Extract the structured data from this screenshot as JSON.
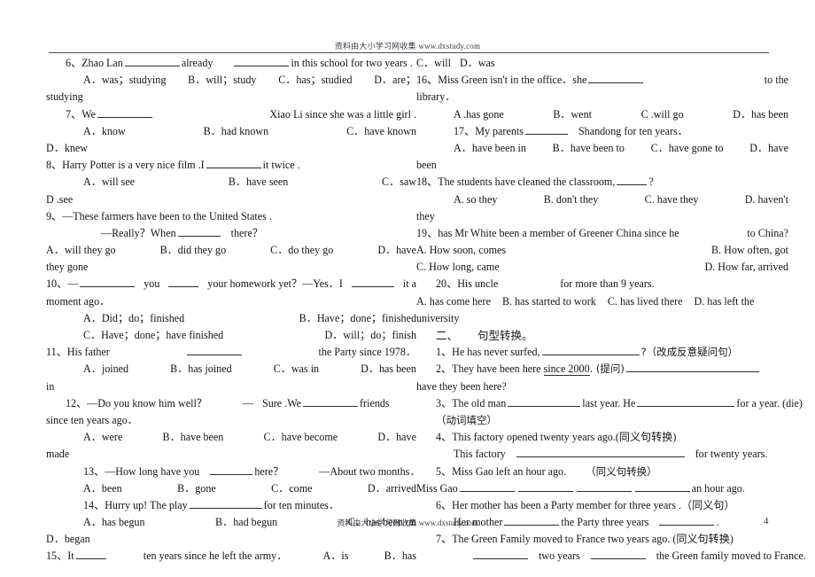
{
  "header": {
    "watermark_cn": "资料由大小学习网收集",
    "watermark_url": "www.dxstudy.com"
  },
  "footer": {
    "watermark_cn": "资料由大小学习网收集",
    "watermark_url": "www.dxstudy.com",
    "page_number": "4"
  },
  "left_column": {
    "q6": {
      "stem_a": "6、Zhao Lan",
      "stem_b": "already",
      "stem_c": "in this school for two years .",
      "opt_a": "A．was；studying",
      "opt_b": "B．will；study",
      "opt_c": "C．has；studied",
      "opt_d": "D．are；",
      "opt_d_cont": "studying"
    },
    "q7": {
      "stem": "7、We",
      "stem_cont": "Xiao Li since she was a little girl .",
      "opt_a": "A．know",
      "opt_b": "B．had known",
      "opt_c": "C．have known",
      "opt_d": "D．knew"
    },
    "q8": {
      "stem_a": "8、Harry Potter is a very nice film .I",
      "stem_b": "it twice .",
      "opt_a": "A．will see",
      "opt_b": "B．have seen",
      "opt_c": "C．saw",
      "opt_d": "D .see"
    },
    "q9": {
      "stem_a": "9、—These farmers have been to the United States .",
      "stem_b": "—Really？When",
      "stem_b_cont": "there？",
      "opt_a": "A．will they go",
      "opt_b": "B．did they go",
      "opt_c": "C．do they go",
      "opt_d": "D．have",
      "opt_d_cont": "they gone"
    },
    "q10": {
      "stem_a": "10、—",
      "stem_b": "you",
      "stem_c": "your homework yet？—Yes．I",
      "stem_d": "it a",
      "stem_e": "moment ago．",
      "opt_a": "A．Did；do；finished",
      "opt_b": "B．Have；done；finished",
      "opt_c": "C．Have；done；have finished",
      "opt_d": "D．will；do；finish"
    },
    "q11": {
      "stem_a": "11、His father",
      "stem_b": "the Party since 1978．",
      "opt_a": "A．joined",
      "opt_b": "B．has joined",
      "opt_c": "C．was in",
      "opt_d": "D．has been",
      "opt_d_cont": "in"
    },
    "q12": {
      "stem_a": "12、—Do you know him well？",
      "stem_b": "—",
      "stem_c": "Sure .We",
      "stem_d": "friends",
      "stem_e": "since ten years ago．",
      "opt_a": "A．were",
      "opt_b": "B．have been",
      "opt_c": "C．have become",
      "opt_d": "D．have",
      "opt_d_cont": "made"
    },
    "q13": {
      "stem_a": "13、—How long have you",
      "stem_b": "here？",
      "stem_c": "—About two months．",
      "opt_a": "A．been",
      "opt_b": "B．gone",
      "opt_c": "C．come",
      "opt_d": "D．arrived"
    },
    "q14": {
      "stem_a": "14、Hurry up! The play",
      "stem_b": "for ten minutes．",
      "opt_a": "A．has begun",
      "opt_b": "B．had begun",
      "opt_c": "C．has been on",
      "opt_d": "D．began"
    },
    "q15": {
      "stem_a": "15、It",
      "stem_b": "ten years since he left the army．",
      "opt_a": "A．is",
      "opt_b": "B．has"
    }
  },
  "right_column": {
    "q15_cont": {
      "opt_c": "C．will",
      "opt_d": "D．was"
    },
    "q16": {
      "stem_a": "16、Miss Green isn't in the office．she",
      "stem_b": "to the",
      "stem_c": "library．",
      "opt_a": "A .has gone",
      "opt_b": "B．went",
      "opt_c": "C .will go",
      "opt_d": "D．has been"
    },
    "q17": {
      "stem_a": "17、My parents",
      "stem_b": "Shandong for ten years．",
      "opt_a": "A．have been in",
      "opt_b": "B．have been to",
      "opt_c": "C．have gone to",
      "opt_d": "D．have",
      "opt_d_cont": "been"
    },
    "q18": {
      "stem": "18、The students have cleaned the classroom,",
      "stem_cont": "?",
      "opt_a": "A. so they",
      "opt_b": "B. don't they",
      "opt_c": "C. have they",
      "opt_d": "D. haven't",
      "opt_d_cont": "they"
    },
    "q19": {
      "stem_a": "19、has Mr White been a member of Greener China since he",
      "stem_b": "to China?",
      "opt_a": "A. How soon, comes",
      "opt_b": "B. How often, got",
      "opt_c": "C. How long, came",
      "opt_d": "D. How far, arrived"
    },
    "q20": {
      "stem_a": "20、His uncle",
      "stem_b": "for more than 9 years.",
      "opt_a": "A. has come here",
      "opt_b": "B. has started to work",
      "opt_c": "C. has lived there",
      "opt_d": "D. has left the",
      "opt_d_cont": "university"
    },
    "section2": {
      "number": "二、",
      "title": "句型转换。",
      "items": [
        {
          "stem_a": "1、He has never surfed,",
          "stem_b": "?（改成反意疑问句）"
        },
        {
          "stem_a": "2、They have been here",
          "underlined": "since 2000",
          "stem_b": ". (提问)",
          "stem_c": "have they been here?"
        },
        {
          "stem_a": "3、The old man",
          "stem_b": "last year. He",
          "stem_c": "for a year. (die)",
          "stem_d": "（动词填空）"
        },
        {
          "stem_a": "4、This factory opened twenty years ago.(同义句转换)",
          "stem_b": "This factory",
          "stem_c": "for twenty years."
        },
        {
          "stem_a": "5、Miss Gao left an hour ago.",
          "stem_a2": "（同义句转换）",
          "stem_b": "Miss Gao",
          "stem_c": "an hour ago."
        },
        {
          "stem_a": "6、Her mother has been a Party member for three years .（同义句）",
          "stem_b": "Her mother",
          "stem_c": "the Party three years",
          "stem_d": "."
        },
        {
          "stem_a": "7、The Green Family moved to France two years ago. (同义句转换)",
          "stem_b": "two years",
          "stem_c": "the Green family moved to France."
        }
      ]
    }
  }
}
